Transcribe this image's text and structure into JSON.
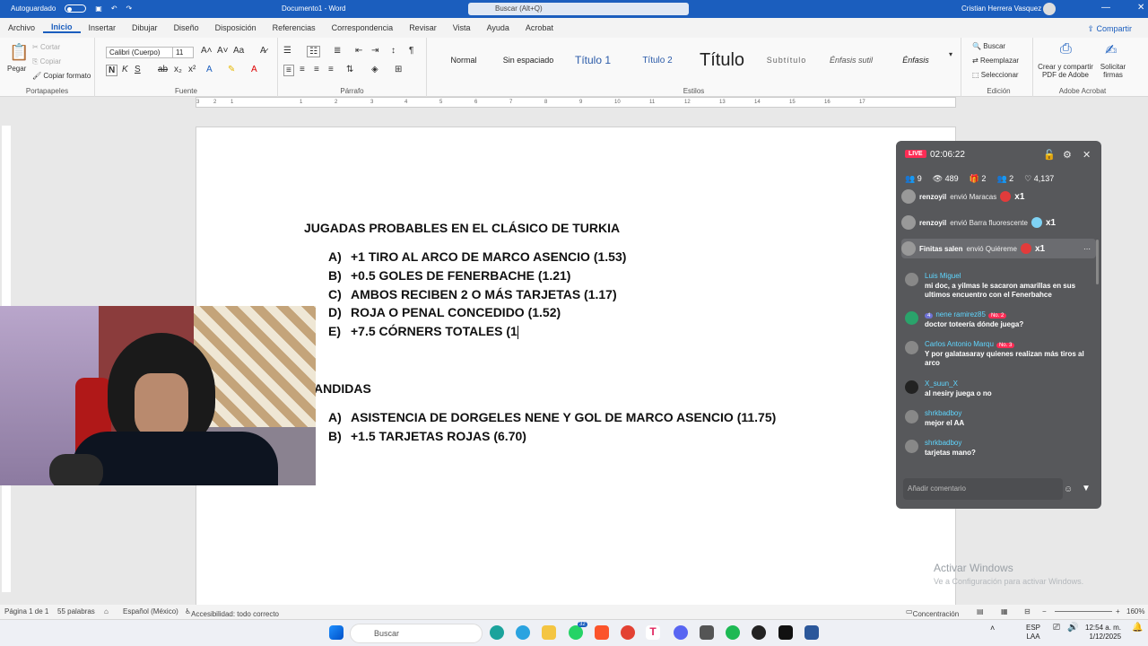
{
  "titlebar": {
    "autosave": "Autoguardado",
    "doc_title": "Documento1 - Word",
    "search": "Buscar (Alt+Q)",
    "user": "Cristian Herrera Vasquez",
    "minimize": "—",
    "close": "✕"
  },
  "menu": {
    "tabs": [
      "Archivo",
      "Inicio",
      "Insertar",
      "Dibujar",
      "Diseño",
      "Disposición",
      "Referencias",
      "Correspondencia",
      "Revisar",
      "Vista",
      "Ayuda",
      "Acrobat"
    ],
    "share": "Compartir"
  },
  "ribbon": {
    "clipboard": {
      "paste": "Pegar",
      "cut": "Cortar",
      "copy": "Copiar",
      "format_painter": "Copiar formato",
      "label": "Portapapeles"
    },
    "font": {
      "family": "Calibri (Cuerpo)",
      "size": "11",
      "label": "Fuente",
      "buttons": [
        "N",
        "K",
        "S",
        "ab",
        "x₂",
        "x²"
      ]
    },
    "paragraph": {
      "label": "Párrafo"
    },
    "styles": {
      "items": [
        "Normal",
        "Sin espaciado",
        "Título 1",
        "Título 2",
        "Título",
        "Subtítulo",
        "Énfasis sutil",
        "Énfasis"
      ],
      "label": "Estilos"
    },
    "editing": {
      "search": "Buscar",
      "replace": "Reemplazar",
      "select": "Seleccionar",
      "label": "Edición"
    },
    "acrobat": {
      "create_pdf": "Crear y compartir PDF de Adobe",
      "request_sign": "Solicitar firmas",
      "label": "Adobe Acrobat"
    }
  },
  "ruler": {
    "marks": [
      "3",
      "2",
      "1",
      "1",
      "2",
      "3",
      "4",
      "5",
      "6",
      "7",
      "8",
      "9",
      "10",
      "11",
      "12",
      "13",
      "14",
      "15",
      "16",
      "17"
    ]
  },
  "document": {
    "heading1": "JUGADAS PROBABLES EN EL CLÁSICO DE TURKIA",
    "items1": [
      {
        "letter": "A)",
        "text": "+1 TIRO AL ARCO DE MARCO ASENCIO (1.53)"
      },
      {
        "letter": "B)",
        "text": "+0.5 GOLES DE FENERBACHE (1.21)"
      },
      {
        "letter": "C)",
        "text": "AMBOS RECIBEN 2 O MÁS TARJETAS (1.17)"
      },
      {
        "letter": "D)",
        "text": "ROJA O PENAL CONCEDIDO (1.52)"
      },
      {
        "letter": "E)",
        "text": "+7.5 CÓRNERS TOTALES (1"
      }
    ],
    "heading2": "ANDIDAS",
    "items2": [
      {
        "letter": "A)",
        "text": "ASISTENCIA DE DORGELES NENE Y GOL DE MARCO ASENCIO (11.75)"
      },
      {
        "letter": "B)",
        "text": "+1.5 TARJETAS ROJAS (6.70)"
      }
    ]
  },
  "live": {
    "badge": "LIVE",
    "timer": "02:06:22",
    "stats": {
      "guests": "9",
      "viewers": "489",
      "gifts": "2",
      "shares": "2",
      "likes": "4,137"
    },
    "gifts": [
      {
        "user": "renzoyil",
        "action": "envió Maracas",
        "mult": "x1",
        "color": "#e23b3b"
      },
      {
        "user": "renzoyil",
        "action": "envió Barra fluorescente",
        "mult": "x1",
        "color": "#7fd3f5"
      },
      {
        "user": "Finitas salen",
        "action": "envió Quiéreme",
        "mult": "x1",
        "color": "#e23b3b"
      }
    ],
    "chat": [
      {
        "name": "Luis Miguel",
        "level": "",
        "rank": "",
        "text": "mi doc, a yilmas le sacaron amarillas en sus ultimos encuentro con el Fenerbahce"
      },
      {
        "name": "nene ramirez85",
        "level": "4",
        "rank": "No. 2",
        "text": "doctor toteería dónde juega?"
      },
      {
        "name": "Carlos Antonio Marqu",
        "level": "",
        "rank": "No. 3",
        "text": "Y por galatasaray quienes realizan más tiros al arco"
      },
      {
        "name": "X_suun_X",
        "level": "",
        "rank": "",
        "text": "al nesiry juega o no"
      },
      {
        "name": "shrkbadboy",
        "level": "",
        "rank": "",
        "text": "mejor el AA"
      },
      {
        "name": "shrkbadboy",
        "level": "",
        "rank": "",
        "text": "tarjetas mano?"
      }
    ],
    "comment_placeholder": "Añadir comentario"
  },
  "watermark": {
    "line1": "Activar Windows",
    "line2": "Ve a Configuración para activar Windows."
  },
  "statusbar": {
    "page": "Página 1 de 1",
    "words": "55 palabras",
    "language": "Español (México)",
    "accessibility": "Accesibilidad: todo correcto",
    "focus": "Concentración",
    "zoom": "160%"
  },
  "taskbar": {
    "search": "Buscar",
    "lang": "ESP",
    "lang2": "LAA",
    "time": "12:54 a. m.",
    "date": "1/12/2025",
    "whatsapp_badge": "32"
  }
}
